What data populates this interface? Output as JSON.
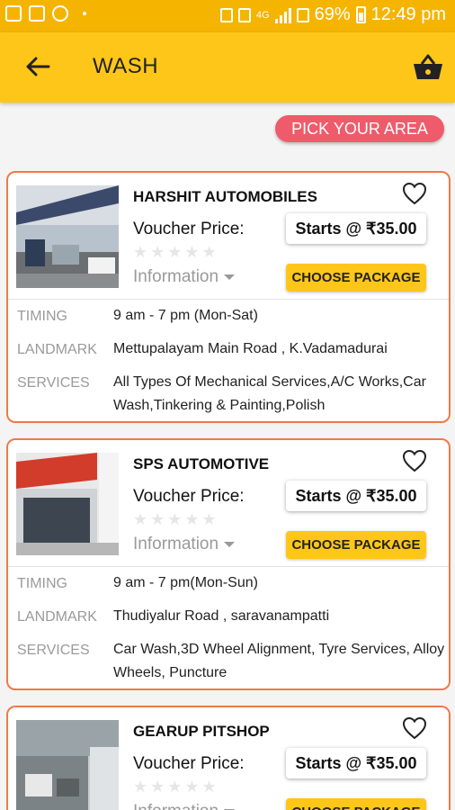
{
  "status_bar": {
    "battery": "69%",
    "time": "12:49 pm",
    "network": "4G"
  },
  "app_bar": {
    "title": "WASH"
  },
  "pick_area_label": "PICK YOUR AREA",
  "cards": [
    {
      "name": "HARSHIT AUTOMOBILES",
      "voucher_label": "Voucher Price:",
      "price": "Starts @ ₹35.00",
      "rating": "★★★★★",
      "info_label": "Information",
      "button_label": "CHOOSE PACKAGE",
      "timing_label": "TIMING",
      "timing": "9 am - 7 pm (Mon-Sat)",
      "landmark_label": "LANDMARK",
      "landmark": "Mettupalayam Main Road , K.Vadamadurai",
      "services_label": "SERVICES",
      "services": "All Types Of Mechanical Services,A/C Works,Car Wash,Tinkering & Painting,Polish"
    },
    {
      "name": "SPS AUTOMOTIVE",
      "voucher_label": "Voucher Price:",
      "price": "Starts @ ₹35.00",
      "rating": "★★★★★",
      "info_label": "Information",
      "button_label": "CHOOSE PACKAGE",
      "timing_label": "TIMING",
      "timing": "9 am - 7 pm(Mon-Sun)",
      "landmark_label": "LANDMARK",
      "landmark": "Thudiyalur Road , saravanampatti",
      "services_label": "SERVICES",
      "services": "Car Wash,3D Wheel Alignment, Tyre Services, Alloy Wheels, Puncture"
    },
    {
      "name": "GEARUP PITSHOP",
      "voucher_label": "Voucher Price:",
      "price": "Starts @ ₹35.00",
      "rating": "★★★★★",
      "info_label": "Information",
      "button_label": "CHOOSE PACKAGE"
    }
  ],
  "colors": {
    "accent": "#ffc61a",
    "status": "#f5b400",
    "pick": "#ef5b6a",
    "card_border": "#ee7a4a"
  }
}
